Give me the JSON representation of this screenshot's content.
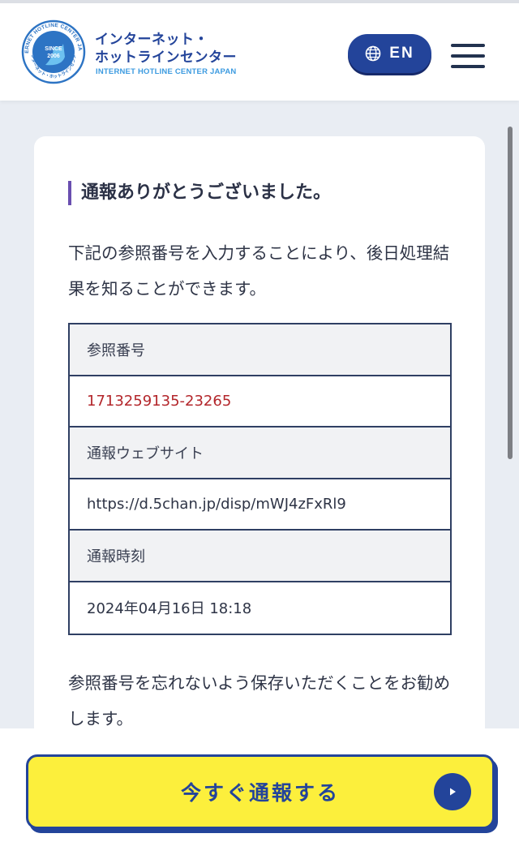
{
  "header": {
    "logo_name_line1": "インターネット・",
    "logo_name_line2": "ホットラインセンター",
    "logo_name_en": "INTERNET HOTLINE CENTER JAPAN",
    "logo_seal_text": "INTERNET HOTLINE CENTER JAPAN",
    "logo_seal_since": "SINCE",
    "logo_seal_year": "2006",
    "logo_seal_jp": "インターネット・ホットラインセンター",
    "language_button_label": "EN",
    "language_icon": "globe-icon",
    "menu_icon": "hamburger-menu-icon"
  },
  "card": {
    "title": "通報ありがとうございました。",
    "intro": "下記の参照番号を入力することにより、後日処理結果を知ることができます。",
    "table": {
      "reference_label": "参照番号",
      "reference_value": "1713259135-23265",
      "website_label": "通報ウェブサイト",
      "website_value": "https://d.5chan.jp/disp/mWJ4zFxRl9",
      "time_label": "通報時刻",
      "time_value": "2024年04月16日 18:18"
    },
    "note": "参照番号を忘れないよう保存いただくことをお勧めします。"
  },
  "footer": {
    "report_button_label": "今すぐ通報する",
    "report_button_icon": "play-arrow-icon"
  },
  "colors": {
    "brand_navy": "#23449a",
    "button_yellow": "#fcef3c",
    "reference_red": "#b3262b",
    "title_accent": "#6a4fb0",
    "page_background": "#e9edf3"
  }
}
